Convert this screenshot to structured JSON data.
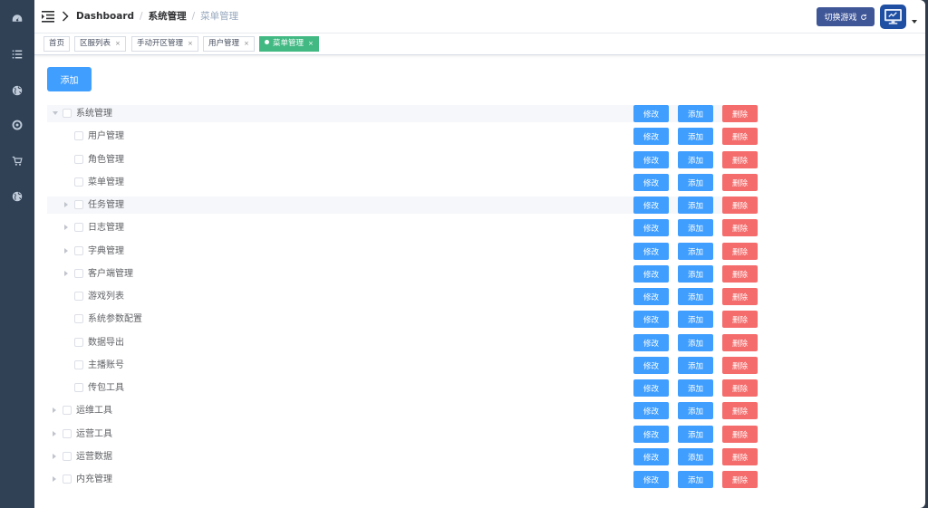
{
  "sidebar": {
    "items": [
      {
        "icon": "dashboard-icon"
      },
      {
        "icon": "list-icon"
      },
      {
        "icon": "globe-icon"
      },
      {
        "icon": "target-icon"
      },
      {
        "icon": "cart-icon"
      },
      {
        "icon": "globe-icon"
      }
    ]
  },
  "header": {
    "breadcrumb": [
      "Dashboard",
      "系统管理",
      "菜单管理"
    ],
    "switch_label": "切换游戏"
  },
  "tags": [
    {
      "label": "首页",
      "closable": false,
      "active": false
    },
    {
      "label": "区服列表",
      "closable": true,
      "active": false
    },
    {
      "label": "手动开区管理",
      "closable": true,
      "active": false
    },
    {
      "label": "用户管理",
      "closable": true,
      "active": false
    },
    {
      "label": "菜单管理",
      "closable": true,
      "active": true
    }
  ],
  "main": {
    "add_label": "添加",
    "actions": {
      "edit": "修改",
      "add": "添加",
      "delete": "删除"
    },
    "tree": [
      {
        "label": "系统管理",
        "level": 0,
        "expander": "down",
        "highlight": true
      },
      {
        "label": "用户管理",
        "level": 1,
        "expander": "none"
      },
      {
        "label": "角色管理",
        "level": 1,
        "expander": "none"
      },
      {
        "label": "菜单管理",
        "level": 1,
        "expander": "none"
      },
      {
        "label": "任务管理",
        "level": 1,
        "expander": "right",
        "highlight": true
      },
      {
        "label": "日志管理",
        "level": 1,
        "expander": "right"
      },
      {
        "label": "字典管理",
        "level": 1,
        "expander": "right"
      },
      {
        "label": "客户端管理",
        "level": 1,
        "expander": "right"
      },
      {
        "label": "游戏列表",
        "level": 1,
        "expander": "none"
      },
      {
        "label": "系统参数配置",
        "level": 1,
        "expander": "none"
      },
      {
        "label": "数据导出",
        "level": 1,
        "expander": "none"
      },
      {
        "label": "主播账号",
        "level": 1,
        "expander": "none"
      },
      {
        "label": "传包工具",
        "level": 1,
        "expander": "none"
      },
      {
        "label": "运维工具",
        "level": 0,
        "expander": "right"
      },
      {
        "label": "运营工具",
        "level": 0,
        "expander": "right"
      },
      {
        "label": "运营数据",
        "level": 0,
        "expander": "right"
      },
      {
        "label": "内充管理",
        "level": 0,
        "expander": "right"
      }
    ]
  },
  "colors": {
    "sidebar": "#304156",
    "primary": "#409eff",
    "danger": "#f56c6c",
    "active_tag": "#42b983",
    "switch_button": "#3f5697"
  }
}
